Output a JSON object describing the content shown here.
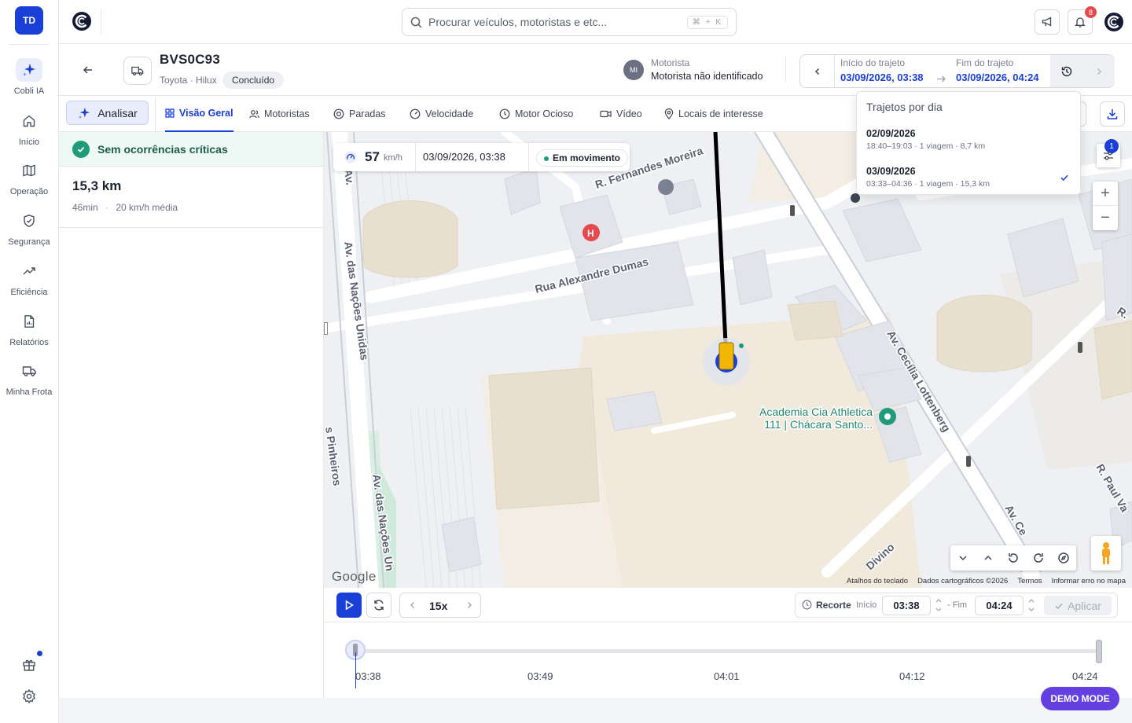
{
  "sidebar": {
    "avatar_initials": "TD",
    "items": [
      {
        "label": "Cobli IA",
        "icon": "sparkles-icon"
      },
      {
        "label": "Início",
        "icon": "home-icon"
      },
      {
        "label": "Operação",
        "icon": "map-icon"
      },
      {
        "label": "Segurança",
        "icon": "shield-icon"
      },
      {
        "label": "Eficiência",
        "icon": "trending-up-icon"
      },
      {
        "label": "Relatórios",
        "icon": "report-icon"
      },
      {
        "label": "Minha Frota",
        "icon": "truck-icon"
      }
    ]
  },
  "topbar": {
    "search_placeholder": "Procurar veículos, motoristas e etc...",
    "search_shortcut": "⌘ + K",
    "notifications_count": "8"
  },
  "vehicle": {
    "plate": "BVS0C93",
    "model": "Toyota · Hilux",
    "status": "Concluído"
  },
  "driver": {
    "initials": "MI",
    "caption": "Motorista",
    "name": "Motorista não identificado"
  },
  "trip": {
    "start_label": "Início do trajeto",
    "start_value": "03/09/2026, 03:38",
    "end_label": "Fim do trajeto",
    "end_value": "03/09/2026, 04:24"
  },
  "tabs": {
    "analyze": "Analisar",
    "items": [
      "Visão Geral",
      "Motoristas",
      "Paradas",
      "Velocidade",
      "Motor Ocioso",
      "Vídeo",
      "Locais de interesse"
    ],
    "partial_button_text": "s"
  },
  "summary": {
    "alert": "Sem ocorrências críticas",
    "distance": "15,3 km",
    "duration": "46min",
    "avg_speed": "20 km/h média"
  },
  "map": {
    "speed": "57",
    "speed_unit": "km/h",
    "timestamp": "03/09/2026, 03:38",
    "movement_status": "Em movimento",
    "filter_badge": "1",
    "poi_name": "Academia Cia Athletica",
    "poi_address": "111 | Chácara Santo...",
    "streets": [
      "R. Fernandes Moreira",
      "Rua Alexandre Dumas",
      "Av. das Nações Unidas",
      "Av. das Nações Un",
      "Av. Cecília Lottenberg",
      "R. Paul Va",
      "Av. Ce",
      "Divino",
      "Av.",
      "R.",
      "s Pinheiros"
    ],
    "google": "Google",
    "attribution": [
      "Atalhos do teclado",
      "Dados cartográficos ©2026",
      "Termos",
      "Informar erro no mapa"
    ]
  },
  "trips_dropdown": {
    "title": "Trajetos por dia",
    "items": [
      {
        "date": "02/09/2026",
        "detail": "18:40–19:03 · 1 viagem · 8,7 km",
        "selected": false
      },
      {
        "date": "03/09/2026",
        "detail": "03:33–04:36 · 1 viagem · 15,3 km",
        "selected": true
      }
    ]
  },
  "playback": {
    "speed": "15x",
    "clip_label": "Recorte",
    "start_label": "Início",
    "start_time": "03:38",
    "end_label": "- Fim",
    "end_time": "04:24",
    "apply": "Aplicar",
    "ticks": [
      "03:38",
      "03:49",
      "04:01",
      "04:12",
      "04:24"
    ],
    "progress": 0
  },
  "demo_mode": "DEMO MODE",
  "colors": {
    "accent": "#1a3fd6",
    "success": "#1f9b7a",
    "demo": "#6440e0",
    "alert": "#e5484d"
  }
}
